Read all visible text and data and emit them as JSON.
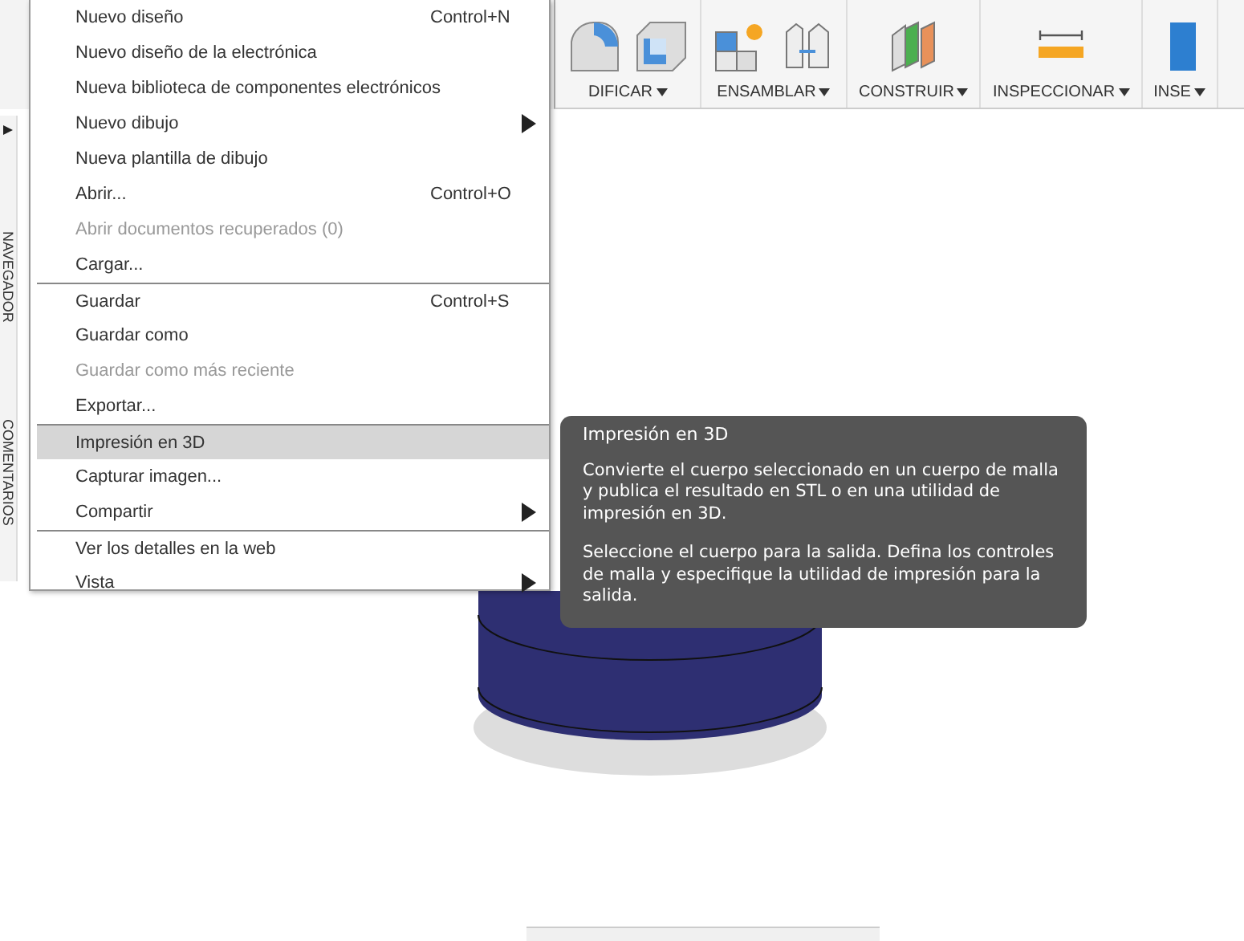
{
  "toolbar": {
    "groups": [
      {
        "label": "DIFICAR"
      },
      {
        "label": "ENSAMBLAR"
      },
      {
        "label": "CONSTRUIR"
      },
      {
        "label": "INSPECCIONAR"
      },
      {
        "label": "INSE"
      }
    ]
  },
  "side_panel": {
    "tabs": [
      {
        "label": "NAVEGADOR"
      },
      {
        "label": "COMENTARIOS"
      }
    ]
  },
  "file_menu": {
    "items": [
      {
        "label": "Nuevo diseño",
        "shortcut": "Control+N",
        "disabled": false,
        "selected": false,
        "submenu": false,
        "separator_before": false
      },
      {
        "label": "Nuevo diseño de la electrónica",
        "disabled": false,
        "selected": false,
        "submenu": false,
        "separator_before": false
      },
      {
        "label": "Nueva biblioteca de componentes electrónicos",
        "disabled": false,
        "selected": false,
        "submenu": false,
        "separator_before": false
      },
      {
        "label": "Nuevo dibujo",
        "disabled": false,
        "selected": false,
        "submenu": true,
        "separator_before": false
      },
      {
        "label": "Nueva plantilla de dibujo",
        "disabled": false,
        "selected": false,
        "submenu": false,
        "separator_before": false
      },
      {
        "label": "Abrir...",
        "shortcut": "Control+O",
        "disabled": false,
        "selected": false,
        "submenu": false,
        "separator_before": false
      },
      {
        "label": "Abrir documentos recuperados (0)",
        "disabled": true,
        "selected": false,
        "submenu": false,
        "separator_before": false
      },
      {
        "label": "Cargar...",
        "disabled": false,
        "selected": false,
        "submenu": false,
        "separator_before": false
      },
      {
        "label": "Guardar",
        "shortcut": "Control+S",
        "disabled": false,
        "selected": false,
        "submenu": false,
        "separator_before": true
      },
      {
        "label": "Guardar como",
        "disabled": false,
        "selected": false,
        "submenu": false,
        "separator_before": false
      },
      {
        "label": "Guardar como más reciente",
        "disabled": true,
        "selected": false,
        "submenu": false,
        "separator_before": false
      },
      {
        "label": "Exportar...",
        "disabled": false,
        "selected": false,
        "submenu": false,
        "separator_before": false
      },
      {
        "label": "Impresión en 3D",
        "disabled": false,
        "selected": true,
        "submenu": false,
        "separator_before": true
      },
      {
        "label": "Capturar imagen...",
        "disabled": false,
        "selected": false,
        "submenu": false,
        "separator_before": false
      },
      {
        "label": "Compartir",
        "disabled": false,
        "selected": false,
        "submenu": true,
        "separator_before": false
      },
      {
        "label": "Ver los detalles en la web",
        "disabled": false,
        "selected": false,
        "submenu": false,
        "separator_before": true
      },
      {
        "label": "Vista",
        "disabled": false,
        "selected": false,
        "submenu": true,
        "separator_before": false
      }
    ]
  },
  "tooltip": {
    "title": "Impresión en 3D",
    "paragraphs": [
      "Convierte el cuerpo seleccionado en un cuerpo de malla y publica el resultado en STL o en una utilidad de impresión en 3D.",
      "Seleccione el cuerpo para la salida. Defina los controles de malla y especifique la utilidad de impresión para la salida."
    ]
  }
}
